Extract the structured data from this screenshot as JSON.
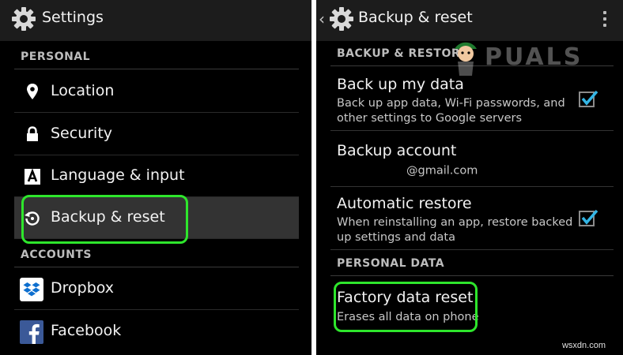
{
  "left": {
    "title": "Settings",
    "section_personal": "PERSONAL",
    "section_accounts": "ACCOUNTS",
    "items": [
      {
        "label": "Location",
        "icon": "location-pin-icon"
      },
      {
        "label": "Security",
        "icon": "lock-icon"
      },
      {
        "label": "Language & input",
        "icon": "language-icon"
      },
      {
        "label": "Backup & reset",
        "icon": "backup-restore-icon",
        "selected": true
      },
      {
        "label": "Dropbox",
        "icon": "dropbox-icon"
      },
      {
        "label": "Facebook",
        "icon": "facebook-icon"
      }
    ]
  },
  "right": {
    "back_glyph": "‹",
    "title": "Backup & reset",
    "section_backup": "BACKUP & RESTORE",
    "section_personal_data": "PERSONAL DATA",
    "backup_my_data": {
      "title": "Back up my data",
      "subtitle": "Back up app data, Wi-Fi passwords, and other settings to Google servers",
      "checked": true
    },
    "backup_account": {
      "title": "Backup account",
      "email_suffix": "@gmail.com"
    },
    "automatic_restore": {
      "title": "Automatic restore",
      "subtitle": "When reinstalling an app, restore backed up settings and data",
      "checked": true
    },
    "factory_reset": {
      "title": "Factory data reset",
      "subtitle": "Erases all data on phone"
    }
  },
  "watermark": {
    "text": "PUALS"
  },
  "site_watermark": "wsxdn.com",
  "colors": {
    "highlight": "#2ee62c",
    "checkmark": "#33b5e5",
    "dropbox": "#0d6fcf",
    "facebook": "#3b5998"
  }
}
